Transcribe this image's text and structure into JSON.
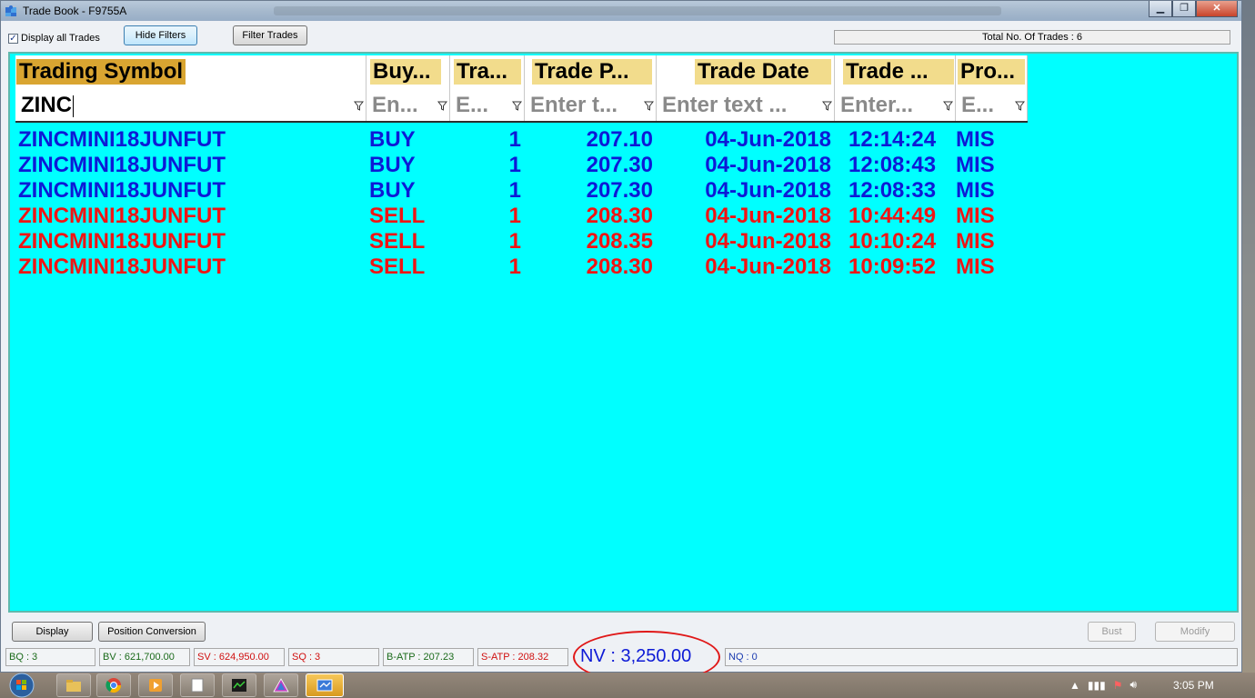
{
  "window": {
    "title": "Trade Book - F9755A",
    "controls": [
      "minimize",
      "maximize",
      "close"
    ]
  },
  "toolbar": {
    "display_all_label": "Display all Trades",
    "display_all_checked": true,
    "hide_filters_label": "Hide Filters",
    "filter_trades_label": "Filter Trades",
    "total_trades": "Total No. Of Trades : 6"
  },
  "grid": {
    "columns": [
      "Trading Symbol",
      "Buy...",
      "Tra...",
      "Trade P...",
      "Trade Date",
      "Trade ...",
      "Pro..."
    ],
    "filters": [
      "ZINC",
      "En...",
      "E...",
      "Enter t...",
      "Enter text ...",
      "Enter...",
      "E..."
    ],
    "rows": [
      {
        "symbol": "ZINCMINI18JUNFUT",
        "side": "BUY",
        "qty": "1",
        "price": "207.10",
        "date": "04-Jun-2018",
        "time": "12:14:24",
        "product": "MIS"
      },
      {
        "symbol": "ZINCMINI18JUNFUT",
        "side": "BUY",
        "qty": "1",
        "price": "207.30",
        "date": "04-Jun-2018",
        "time": "12:08:43",
        "product": "MIS"
      },
      {
        "symbol": "ZINCMINI18JUNFUT",
        "side": "BUY",
        "qty": "1",
        "price": "207.30",
        "date": "04-Jun-2018",
        "time": "12:08:33",
        "product": "MIS"
      },
      {
        "symbol": "ZINCMINI18JUNFUT",
        "side": "SELL",
        "qty": "1",
        "price": "208.30",
        "date": "04-Jun-2018",
        "time": "10:44:49",
        "product": "MIS"
      },
      {
        "symbol": "ZINCMINI18JUNFUT",
        "side": "SELL",
        "qty": "1",
        "price": "208.35",
        "date": "04-Jun-2018",
        "time": "10:10:24",
        "product": "MIS"
      },
      {
        "symbol": "ZINCMINI18JUNFUT",
        "side": "SELL",
        "qty": "1",
        "price": "208.30",
        "date": "04-Jun-2018",
        "time": "10:09:52",
        "product": "MIS"
      }
    ],
    "colors": {
      "background": "#00ffff",
      "buy": "#0d1ad6",
      "sell": "#f01414"
    }
  },
  "actions": {
    "display_label": "Display",
    "position_conversion_label": "Position Conversion",
    "bust_label": "Bust",
    "modify_label": "Modify"
  },
  "status": {
    "bq": "BQ : 3",
    "bv": "BV : 621,700.00",
    "sv": "SV : 624,950.00",
    "sq": "SQ : 3",
    "batp": "B-ATP : 207.23",
    "satp": "S-ATP : 208.32",
    "nv": "NV : 3,250.00",
    "nq": "NQ : 0"
  },
  "taskbar": {
    "clock": "3:05 PM",
    "apps": [
      "windows-explorer-icon",
      "chrome-icon",
      "media-player-icon",
      "notepad-icon",
      "trading-app-icon",
      "prism-app-icon",
      "trade-book-icon"
    ]
  }
}
